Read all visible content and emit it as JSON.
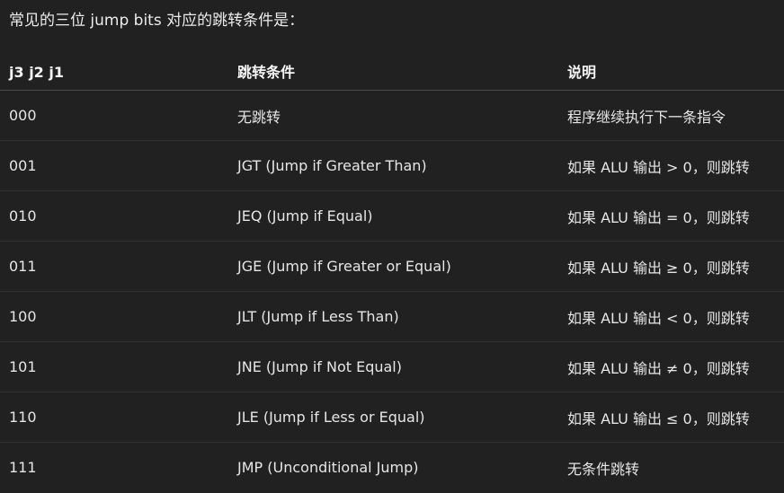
{
  "intro_text": "常见的三位 jump bits 对应的跳转条件是：",
  "table": {
    "headers": [
      "j3 j2 j1",
      "跳转条件",
      "说明"
    ],
    "rows": [
      [
        "000",
        "无跳转",
        "程序继续执行下一条指令"
      ],
      [
        "001",
        "JGT (Jump if Greater Than)",
        "如果 ALU 输出 > 0，则跳转"
      ],
      [
        "010",
        "JEQ (Jump if Equal)",
        "如果 ALU 输出 = 0，则跳转"
      ],
      [
        "011",
        "JGE (Jump if Greater or Equal)",
        "如果 ALU 输出 ≥ 0，则跳转"
      ],
      [
        "100",
        "JLT (Jump if Less Than)",
        "如果 ALU 输出 < 0，则跳转"
      ],
      [
        "101",
        "JNE (Jump if Not Equal)",
        "如果 ALU 输出 ≠ 0，则跳转"
      ],
      [
        "110",
        "JLE (Jump if Less or Equal)",
        "如果 ALU 输出 ≤ 0，则跳转"
      ],
      [
        "111",
        "JMP (Unconditional Jump)",
        "无条件跳转"
      ]
    ]
  },
  "colors": {
    "background": "#212121",
    "text": "#ececec",
    "header_divider": "#4a4a4a",
    "row_divider": "#2f2f2f"
  }
}
